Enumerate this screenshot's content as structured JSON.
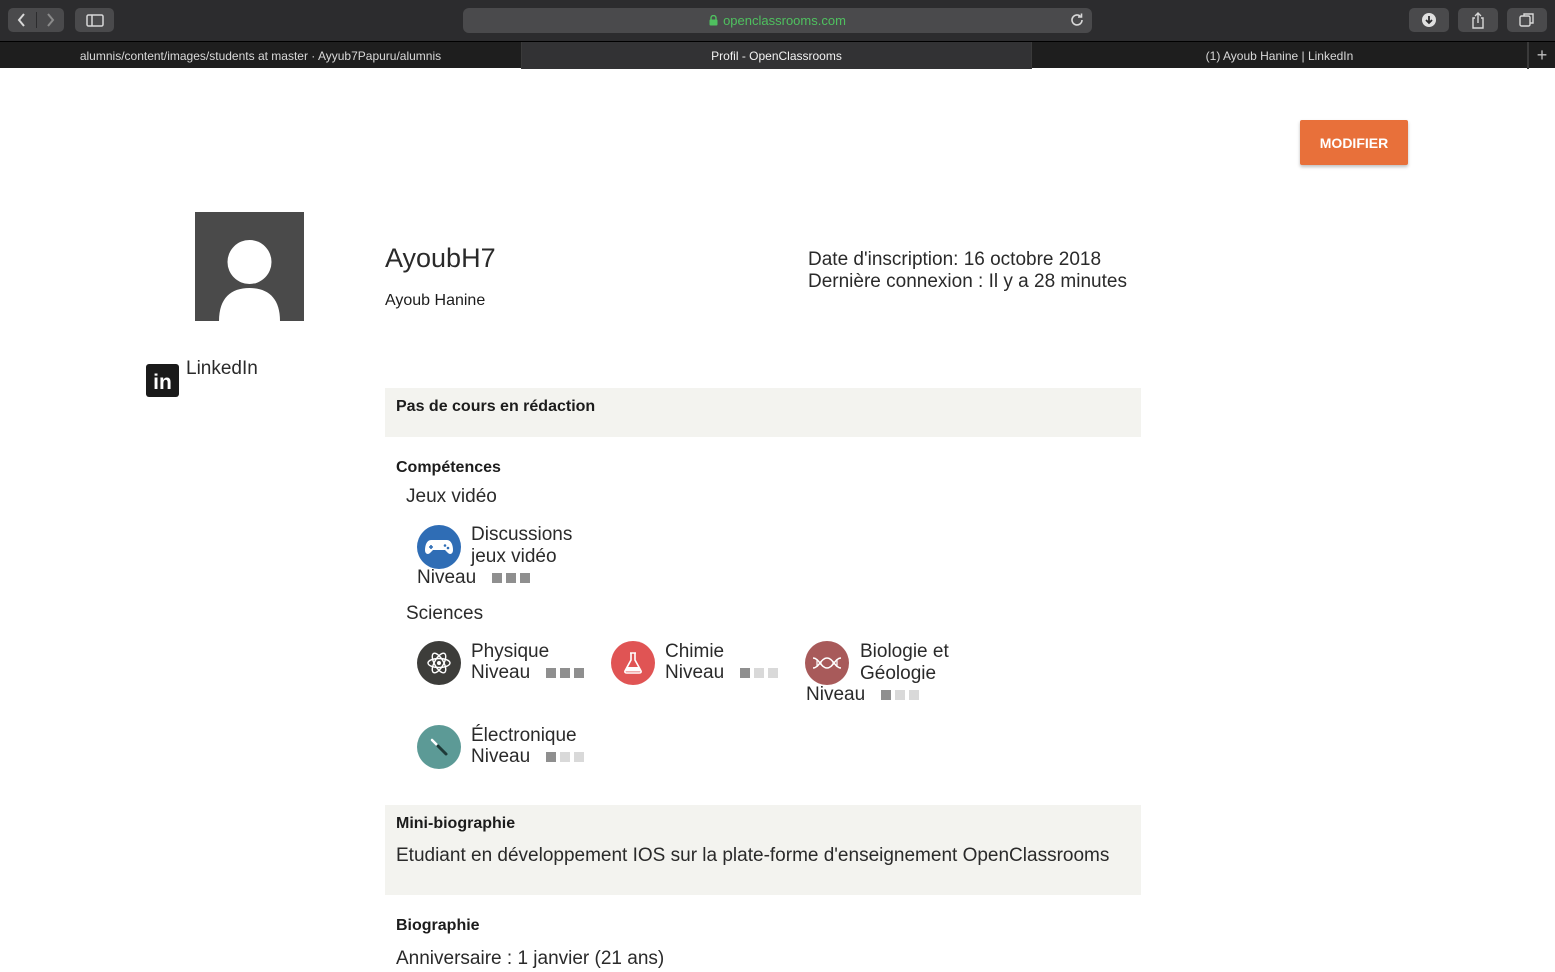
{
  "browser": {
    "url": "openclassrooms.com",
    "tabs": [
      {
        "label": "alumnis/content/images/students at master · Ayyub7Papuru/alumnis",
        "active": false
      },
      {
        "label": "Profil - OpenClassrooms",
        "active": true
      },
      {
        "label": "(1) Ayoub Hanine | LinkedIn",
        "active": false
      }
    ],
    "icons": [
      "back-icon",
      "forward-icon",
      "sidebar-icon",
      "lock-icon",
      "reload-icon",
      "download-icon",
      "share-icon",
      "tabs-overview-icon",
      "plus-icon"
    ]
  },
  "profile": {
    "modify_label": "MODIFIER",
    "username": "AyoubH7",
    "fullname": "Ayoub Hanine",
    "signup": "Date d'inscription: 16 octobre 2018",
    "last_login": "Dernière connexion : Il y a 28 minutes",
    "linkedin_label": "LinkedIn",
    "linkedin_icon_text": "in"
  },
  "drafts": {
    "text": "Pas de cours en rédaction"
  },
  "skills": {
    "title": "Compétences",
    "categories": [
      {
        "name": "Jeux vidéo",
        "items": [
          {
            "name_lines": [
              "Discussions",
              "jeux vidéo"
            ],
            "niveau_label": "Niveau",
            "level": 3,
            "max": 3,
            "icon": "gamepad-icon",
            "color": "#2f6db5"
          }
        ]
      },
      {
        "name": "Sciences",
        "items": [
          {
            "name_lines": [
              "Physique"
            ],
            "niveau_label": "Niveau",
            "level": 3,
            "max": 3,
            "icon": "atom-icon",
            "color": "#3d3d3a"
          },
          {
            "name_lines": [
              "Chimie"
            ],
            "niveau_label": "Niveau",
            "level": 1,
            "max": 3,
            "icon": "flask-icon",
            "color": "#e05454"
          },
          {
            "name_lines": [
              "Biologie et",
              "Géologie"
            ],
            "niveau_label": "Niveau",
            "level": 1,
            "max": 3,
            "icon": "dna-icon",
            "color": "#a85a5a"
          },
          {
            "name_lines": [
              "Électronique"
            ],
            "niveau_label": "Niveau",
            "level": 1,
            "max": 3,
            "icon": "screwdriver-icon",
            "color": "#5c9a96"
          }
        ]
      }
    ]
  },
  "mini_bio": {
    "title": "Mini-biographie",
    "text": "Etudiant en développement IOS sur la plate-forme d'enseignement OpenClassrooms"
  },
  "bio": {
    "title": "Biographie",
    "birthday": "Anniversaire : 1 janvier (21 ans)"
  }
}
